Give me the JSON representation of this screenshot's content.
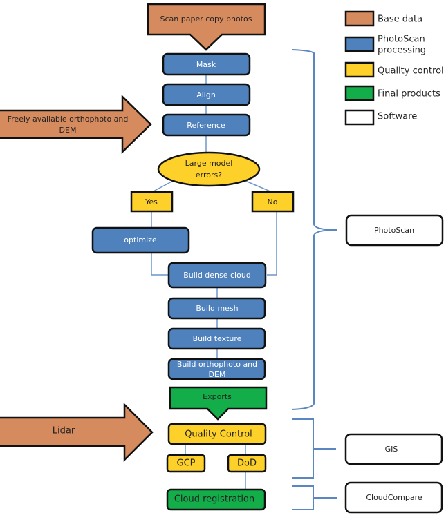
{
  "colors": {
    "base_data": "#d58b5e",
    "photoscan": "#4f81bd",
    "quality": "#fdd02a",
    "final": "#13ad4a",
    "software": "#ffffff",
    "connector": "#6f95c8",
    "outline": "#111111"
  },
  "legend": [
    {
      "label": "Base data",
      "category": "base_data"
    },
    {
      "label": "PhotoScan processing",
      "label_lines": [
        "PhotoScan",
        "processing"
      ],
      "category": "photoscan"
    },
    {
      "label": "Quality control",
      "category": "quality"
    },
    {
      "label": "Final products",
      "category": "final"
    },
    {
      "label": "Software",
      "category": "software"
    }
  ],
  "inputs": {
    "scan": "Scan paper copy photos",
    "ortho_dem_line1": "Freely available orthophoto and",
    "ortho_dem_line2": "DEM",
    "lidar": "Lidar"
  },
  "steps": {
    "mask": "Mask",
    "align": "Align",
    "reference": "Reference",
    "decision_line1": "Large model",
    "decision_line2": "errors?",
    "yes": "Yes",
    "no": "No",
    "optimize": "optimize",
    "dense_cloud": "Build dense cloud",
    "mesh": "Build mesh",
    "texture": "Build texture",
    "ortho_line1": "Build orthophoto and",
    "ortho_line2": "DEM",
    "exports": "Exports",
    "quality_control": "Quality Control",
    "gcp": "GCP",
    "dod": "DoD",
    "cloud_registration": "Cloud registration"
  },
  "software": {
    "photoscan": "PhotoScan",
    "gis": "GIS",
    "cloudcompare": "CloudCompare"
  }
}
